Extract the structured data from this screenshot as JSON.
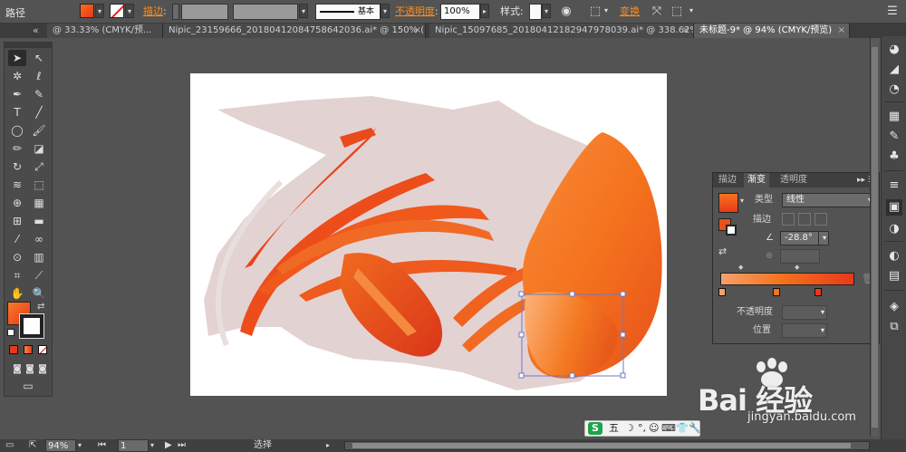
{
  "controlbar": {
    "mode_label": "路径",
    "stroke_label": "描边",
    "stroke_style_label": "基本",
    "opacity_label": "不透明度",
    "opacity_value": "100%",
    "style_label": "样式",
    "transform_label": "变换"
  },
  "tabs": [
    {
      "label": "@ 33.33% (CMYK/预..."
    },
    {
      "label": "Nipic_23159666_20180412084758642036.ai* @ 150% (R..."
    },
    {
      "label": "Nipic_15097685_20180412182947978039.ai* @ 338.62%..."
    },
    {
      "label": "未标题-9* @ 94% (CMYK/预览)"
    }
  ],
  "tab_scroll_label": "«",
  "tab_close": "×",
  "gradient_panel": {
    "tabs": [
      "描边",
      "渐变",
      "透明度"
    ],
    "type_label": "类型",
    "type_value": "线性",
    "stroke_label": "描边",
    "angle_value": "-28.8°",
    "opacity_label": "不透明度",
    "position_label": "位置",
    "colors": {
      "start": "#f7a06a",
      "mid": "#f4731e",
      "end": "#e8391b"
    }
  },
  "statusbar": {
    "zoom": "94%",
    "artboard": "1",
    "tool_name": "选择"
  },
  "ime": {
    "logo": "S",
    "mode": "五",
    "items": [
      "☽",
      "°,",
      "☺",
      "⌨",
      "👕",
      "🔧"
    ]
  },
  "watermark": {
    "brand": "Bai 经验",
    "url": "jingyan.baidu.com"
  },
  "colors": {
    "shrimp_orange": "#f4731e",
    "shrimp_red": "#e63a17",
    "shadow_pink": "#e3d2d2",
    "ui_gray": "#535353",
    "accent_orange": "#ff8c1a"
  }
}
